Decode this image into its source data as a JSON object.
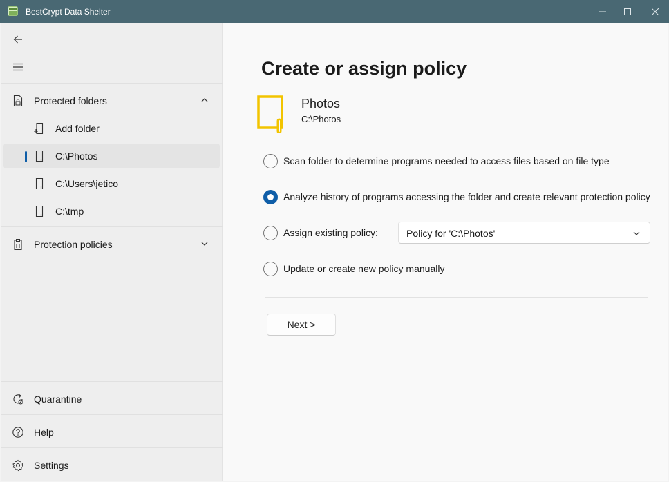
{
  "window": {
    "title": "BestCrypt Data Shelter"
  },
  "sidebar": {
    "protected_folders": {
      "label": "Protected folders",
      "items": [
        {
          "label": "Add folder"
        },
        {
          "label": "C:\\Photos"
        },
        {
          "label": "C:\\Users\\jetico"
        },
        {
          "label": "C:\\tmp"
        }
      ]
    },
    "protection_policies": {
      "label": "Protection policies"
    },
    "bottom": [
      {
        "label": "Quarantine"
      },
      {
        "label": "Help"
      },
      {
        "label": "Settings"
      }
    ]
  },
  "main": {
    "heading": "Create or assign policy",
    "folder": {
      "name": "Photos",
      "path": "C:\\Photos"
    },
    "options": [
      {
        "label": "Scan folder to determine programs needed to access files based on file type",
        "selected": false
      },
      {
        "label": "Analyze history of programs accessing the folder and create relevant protection policy",
        "selected": true
      },
      {
        "label": "Assign existing policy:",
        "selected": false
      },
      {
        "label": "Update or create new policy manually",
        "selected": false
      }
    ],
    "policy_dropdown": {
      "value": "Policy for 'C:\\Photos'"
    },
    "next_button": "Next >"
  },
  "colors": {
    "titlebar": "#496873",
    "accent": "#0f5ea8",
    "folder_icon": "#f2c400"
  }
}
